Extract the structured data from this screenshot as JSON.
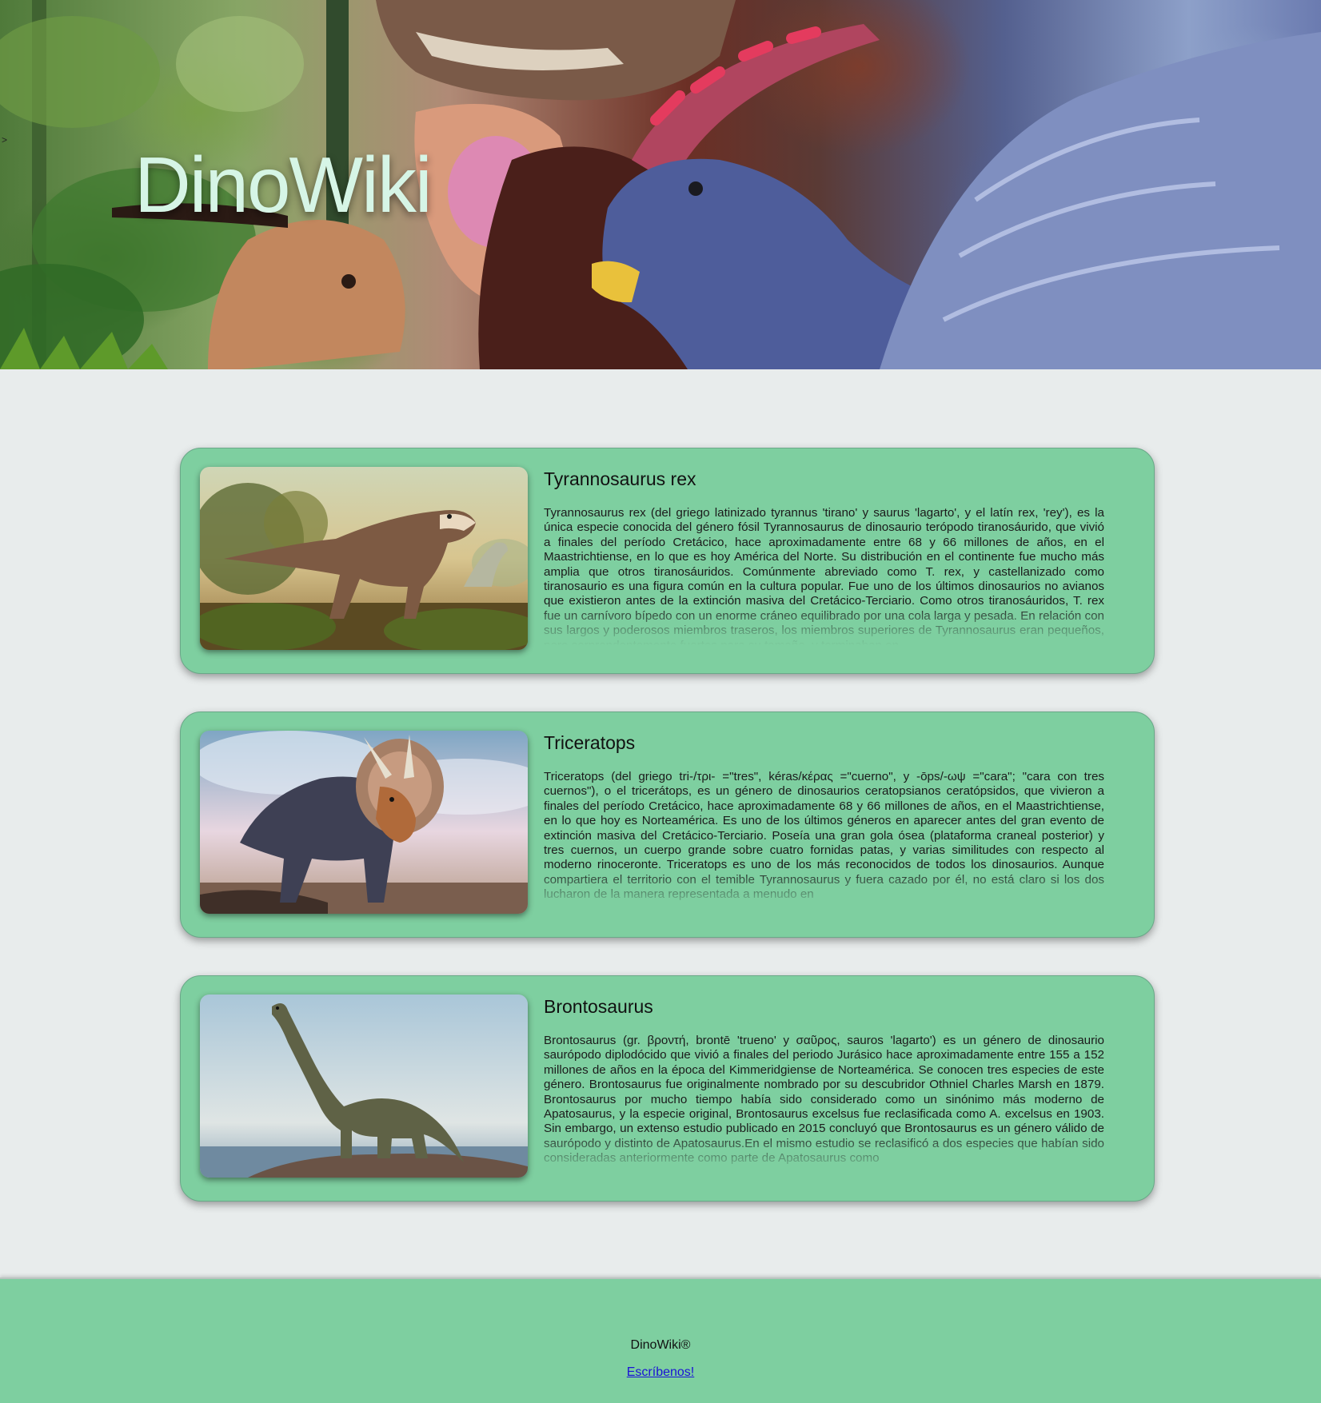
{
  "header": {
    "title": "DinoWiki",
    "stray_mark": ">"
  },
  "cards": [
    {
      "title": "Tyrannosaurus rex",
      "image_alt": "Tyrannosaurus rex",
      "text": "Tyrannosaurus rex (del griego latinizado tyrannus 'tirano' y saurus 'lagarto', y el latín rex, 'rey'), es la única especie conocida del género fósil Tyrannosaurus de dinosaurio terópodo tiranosáurido, que vivió a finales del período Cretácico, hace aproximadamente entre 68 y 66 millones de años, en el Maastrichtiense, en lo que es hoy América del Norte. Su distribución en el continente fue mucho más amplia que otros tiranosáuridos. Comúnmente abreviado como T. rex, y castellanizado como tiranosaurio es una figura común en la cultura popular. Fue uno de los últimos dinosaurios no avianos que existieron antes de la extinción masiva del Cretácico-Terciario. Como otros tiranosáuridos, T. rex fue un carnívoro bípedo con un enorme cráneo equilibrado por una cola larga y pesada. En relación con sus largos y poderosos miembros traseros, los miembros superiores de Tyrannosaurus eran pequeños, pero sorprendentemente fuertes para su tamaño, y terminaban en"
    },
    {
      "title": "Triceratops",
      "image_alt": "Triceratops",
      "text": "Triceratops (del griego tri-/τρι- =\"tres\", kéras/κέρας =\"cuerno\", y -ōps/-ωψ =\"cara\"; \"cara con tres cuernos\"), o el tricerátops, es un género de dinosaurios ceratopsianos ceratópsidos, que vivieron a finales del período Cretácico, hace aproximadamente 68 y 66 millones de años, en el Maastrichtiense, en lo que hoy es Norteamérica. Es uno de los últimos géneros en aparecer antes del gran evento de extinción masiva del Cretácico-Terciario. Poseía una gran gola ósea (plataforma craneal posterior) y tres cuernos, un cuerpo grande sobre cuatro fornidas patas, y varias similitudes con respecto al moderno rinoceronte. Triceratops es uno de los más reconocidos de todos los dinosaurios. Aunque compartiera el territorio con el temible Tyrannosaurus y fuera cazado por él, no está claro si los dos lucharon de la manera representada a menudo en"
    },
    {
      "title": "Brontosaurus",
      "image_alt": "Brontosaurus",
      "text": "Brontosaurus (gr. βροντή, brontē 'trueno' y σαῦρος, sauros 'lagarto') es un género de dinosaurio saurópodo diplodócido que vivió a finales del periodo Jurásico hace aproximadamente entre 155 a 152 millones de años en la época del Kimmeridgiense de Norteamérica. Se conocen tres especies de este género. Brontosaurus fue originalmente nombrado por su descubridor Othniel Charles Marsh en 1879. Brontosaurus por mucho tiempo había sido considerado como un sinónimo más moderno de Apatosaurus, y la especie original, Brontosaurus excelsus fue reclasificada como A. excelsus en 1903. Sin embargo, un extenso estudio publicado en 2015 concluyó que Brontosaurus es un género válido de saurópodo y distinto de Apatosaurus.En el mismo estudio se reclasificó a dos especies que habían sido consideradas anteriormente como parte de Apatosaurus como"
    }
  ],
  "footer": {
    "brand": "DinoWiki®",
    "contact_link": "Escríbenos!"
  },
  "colors": {
    "card_bg": "#7ecfa0",
    "page_bg": "#e8ecec",
    "title_color": "#d6f5e6",
    "link_color": "#1a12d6"
  }
}
